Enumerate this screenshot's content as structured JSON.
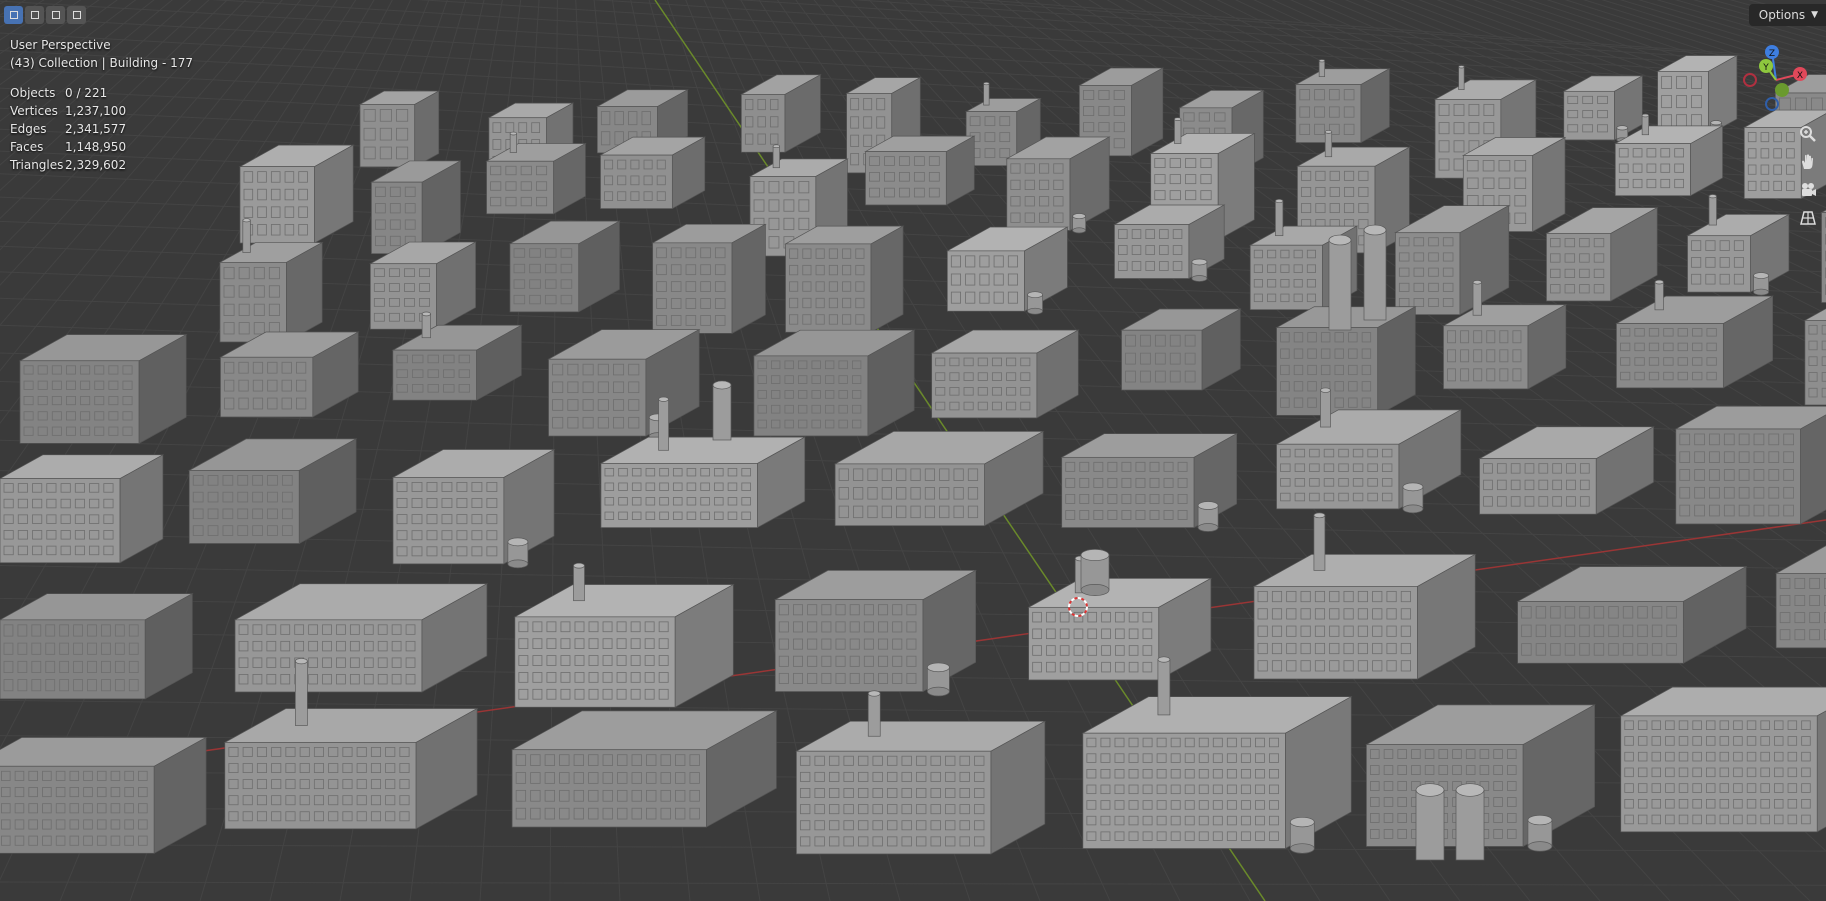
{
  "header": {
    "mode_buttons": [
      "select-box-icon",
      "select-extend-icon",
      "select-subtract-icon",
      "select-intersect-icon"
    ],
    "options_label": "Options"
  },
  "viewport": {
    "perspective_label": "User Perspective",
    "collection_label": "(43) Collection | Building - 177"
  },
  "stats": [
    {
      "label": "Objects",
      "value": "0 / 221"
    },
    {
      "label": "Vertices",
      "value": "1,237,100"
    },
    {
      "label": "Edges",
      "value": "2,341,577"
    },
    {
      "label": "Faces",
      "value": "1,148,950"
    },
    {
      "label": "Triangles",
      "value": "2,329,602"
    }
  ],
  "gizmo": {
    "axes": [
      {
        "label": "X",
        "color": "#e0485a"
      },
      {
        "label": "Y",
        "color": "#8ec73e"
      },
      {
        "label": "Z",
        "color": "#3e7ee0"
      }
    ]
  },
  "nav_tools": [
    "zoom-icon",
    "hand-pan-icon",
    "camera-icon",
    "grid-perspective-icon"
  ],
  "colors": {
    "background": "#3a3a3a",
    "grid": "#444444",
    "x_axis": "#9a3535",
    "y_axis": "#6a8a2a",
    "building": "#9a9a9a"
  }
}
